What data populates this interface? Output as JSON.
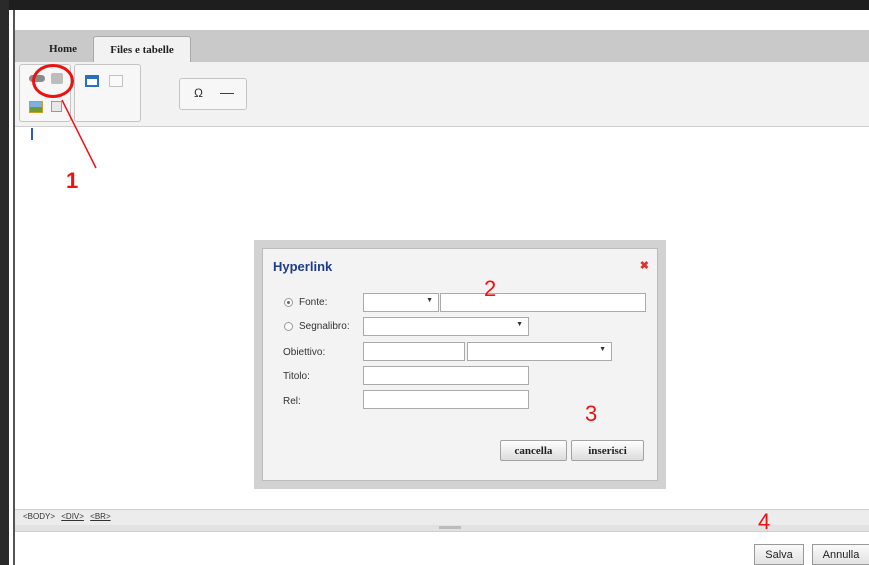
{
  "tabs": [
    {
      "label": "Home"
    },
    {
      "label": "Files e tabelle"
    }
  ],
  "ribbon": {
    "icons": [
      "link-icon",
      "unlink-icon",
      "image-icon",
      "media-icon",
      "table-icon",
      "table-properties-icon",
      "special-char-icon",
      "horizontal-rule-icon"
    ],
    "omega": "Ω",
    "hr": "—"
  },
  "annotations": {
    "n1": "1",
    "n2": "2",
    "n3": "3",
    "n4": "4"
  },
  "dialog": {
    "title": "Hyperlink",
    "close": "✖",
    "fonte": "Fonte:",
    "segnalibro": "Segnalibro:",
    "obiettivo": "Obiettivo:",
    "titolo": "Titolo:",
    "rel": "Rel:",
    "cancel": "cancella",
    "insert": "inserisci",
    "selected_option": "Fonte"
  },
  "statusbar": {
    "body": "<BODY>",
    "div": "<DIV>",
    "br": "<BR>"
  },
  "footer": {
    "save": "Salva",
    "cancel": "Annulla"
  },
  "colors": {
    "annotation": "#e11111",
    "dialog_title": "#1f3c8c"
  }
}
